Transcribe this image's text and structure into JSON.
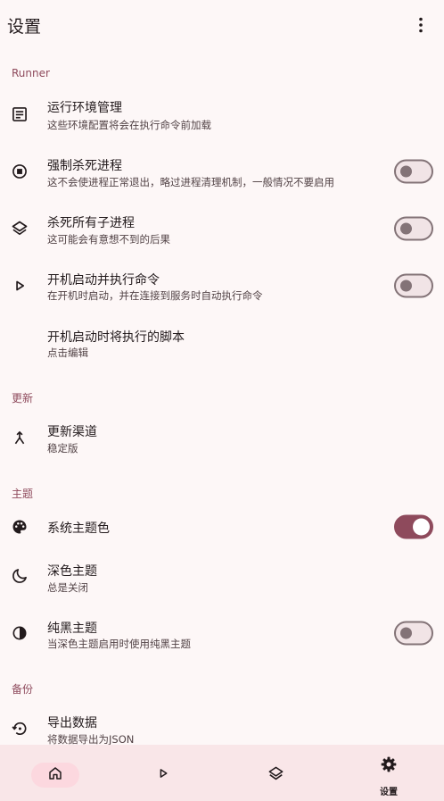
{
  "app": {
    "title": "设置",
    "more_icon": "more-vert-icon"
  },
  "sections": {
    "runner": "Runner",
    "update": "更新",
    "theme": "主题",
    "backup": "备份"
  },
  "items": {
    "env": {
      "title": "运行环境管理",
      "sub": "这些环境配置将会在执行命令前加载"
    },
    "force_kill": {
      "title": "强制杀死进程",
      "sub": "这不会使进程正常退出，略过进程清理机制，一般情况不要启用"
    },
    "kill_children": {
      "title": "杀死所有子进程",
      "sub": "这可能会有意想不到的后果"
    },
    "boot_run": {
      "title": "开机启动并执行命令",
      "sub": "在开机时启动，并在连接到服务时自动执行命令"
    },
    "boot_script": {
      "title": "开机启动时将执行的脚本",
      "sub": "点击编辑"
    },
    "channel": {
      "title": "更新渠道",
      "sub": "稳定版"
    },
    "system_color": {
      "title": "系统主题色"
    },
    "dark": {
      "title": "深色主题",
      "sub": "总是关闭"
    },
    "pure_black": {
      "title": "纯黑主题",
      "sub": "当深色主题启用时使用纯黑主题"
    },
    "export": {
      "title": "导出数据",
      "sub": "将数据导出为JSON"
    }
  },
  "toggles": {
    "force_kill": false,
    "kill_children": false,
    "boot_run": false,
    "system_color": true,
    "pure_black": false
  },
  "nav": {
    "active": "settings",
    "settings_label": "设置"
  },
  "colors": {
    "accent": "#8e4a5c",
    "background": "#fdf7f7",
    "nav_background": "#f9e6e8",
    "nav_indicator": "#fcd8df"
  }
}
